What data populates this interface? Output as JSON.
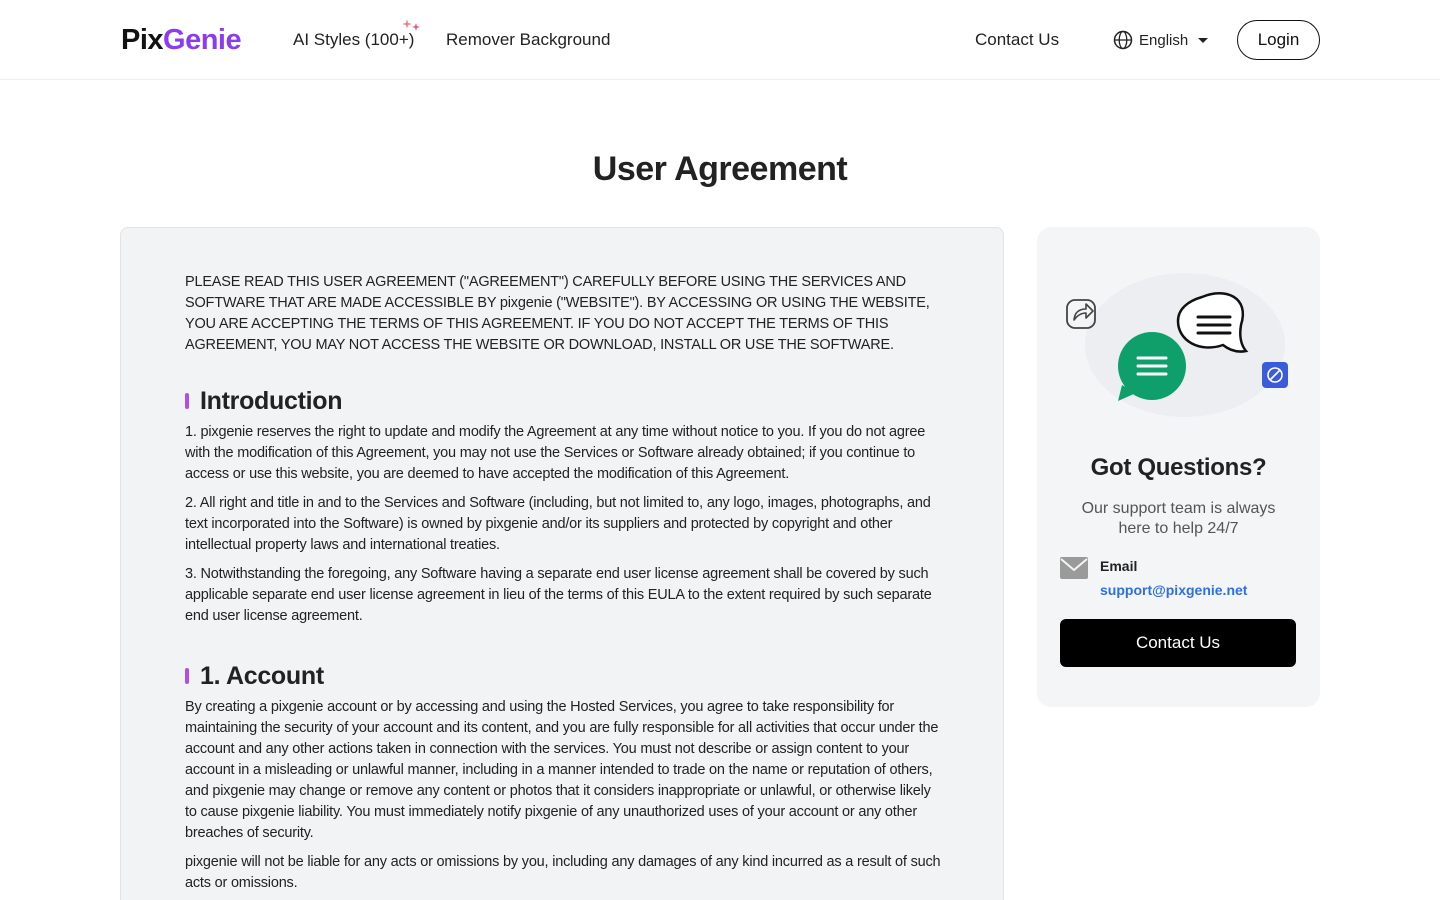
{
  "header": {
    "logo_part1": "Pix",
    "logo_part2": "Genie",
    "nav": {
      "ai_styles": "AI Styles (100+)",
      "remover": "Remover Background",
      "contact": "Contact Us"
    },
    "language": "English",
    "login": "Login"
  },
  "page": {
    "title": "User Agreement"
  },
  "agreement": {
    "intro": "PLEASE READ THIS USER AGREEMENT (\"AGREEMENT\") CAREFULLY BEFORE USING THE SERVICES AND SOFTWARE THAT ARE MADE ACCESSIBLE BY pixgenie (\"WEBSITE\"). BY ACCESSING OR USING THE WEBSITE, YOU ARE ACCEPTING THE TERMS OF THIS AGREEMENT. IF YOU DO NOT ACCEPT THE TERMS OF THIS AGREEMENT, YOU MAY NOT ACCESS THE WEBSITE OR DOWNLOAD, INSTALL OR USE THE SOFTWARE.",
    "sections": [
      {
        "title": "Introduction",
        "paragraphs": [
          "1. pixgenie reserves the right to update and modify the Agreement at any time without notice to you. If you do not agree with the modification of this Agreement, you may not use the Services or Software already obtained; if you continue to access or use this website, you are deemed to have accepted the modification of this Agreement.",
          "2. All right and title in and to the Services and Software (including, but not limited to, any logo, images, photographs, and text incorporated into the Software) is owned by pixgenie and/or its suppliers and protected by copyright and other intellectual property laws and international treaties.",
          "3. Notwithstanding the foregoing, any Software having a separate end user license agreement shall be covered by such applicable separate end user license agreement in lieu of the terms of this EULA to the extent required by such separate end user license agreement."
        ]
      },
      {
        "title": "1. Account",
        "paragraphs": [
          "By creating a pixgenie account or by accessing and using the Hosted Services, you agree to take responsibility for maintaining the security of your account and its content, and you are fully responsible for all activities that occur under the account and any other actions taken in connection with the services. You must not describe or assign content to your account in a misleading or unlawful manner, including in a manner intended to trade on the name or reputation of others, and pixgenie may change or remove any content or photos that it considers inappropriate or unlawful, or otherwise likely to cause pixgenie liability. You must immediately notify pixgenie of any unauthorized uses of your account or any other breaches of security.",
          "pixgenie will not be liable for any acts or omissions by you, including any damages of any kind incurred as a result of such acts or omissions."
        ]
      }
    ]
  },
  "sidebar": {
    "title": "Got Questions?",
    "subtitle": "Our support team is always here to help 24/7",
    "email_label": "Email",
    "email": "support@pixgenie.net",
    "button": "Contact Us"
  },
  "colors": {
    "brand_purple": "#8b3cf0",
    "green_bubble": "#0f9f6a",
    "link_blue": "#2f6fe0",
    "accent_bar": "#b04ee8"
  }
}
